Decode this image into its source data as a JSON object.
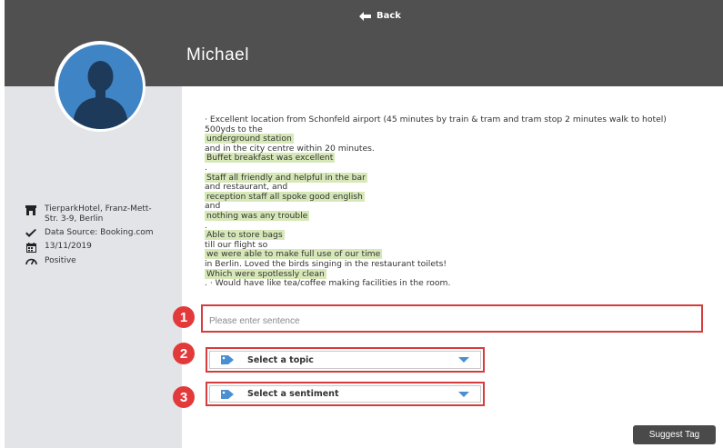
{
  "header": {
    "back_label": "Back",
    "user_name": "Michael"
  },
  "colors": {
    "header_bg": "#505050",
    "sidebar_bg": "#e3e4e8",
    "avatar": "#3f84c4",
    "highlight": "#d7e8b8",
    "callout": "#e23a3a"
  },
  "sidebar": {
    "hotel_lines": [
      "TierparkHotel, Franz-Mett-",
      "Str. 3-9, Berlin"
    ],
    "data_source": "Data Source: Booking.com",
    "date": "13/11/2019",
    "sentiment": "Positive"
  },
  "review": {
    "lines": [
      {
        "text": "· Excellent location from Schonfeld airport (45 minutes by train & tram and tram stop 2 minutes walk to hotel)",
        "highlight": false
      },
      {
        "text": "500yds to the",
        "highlight": false
      },
      {
        "text": "underground station",
        "highlight": true
      },
      {
        "text": "and in the city centre within 20 minutes.",
        "highlight": false
      },
      {
        "text": "Buffet breakfast was excellent",
        "highlight": true
      },
      {
        "text": ".",
        "highlight": false
      },
      {
        "text": "Staff all friendly and helpful in the bar",
        "highlight": true
      },
      {
        "text": "and restaurant, and",
        "highlight": false
      },
      {
        "text": "reception staff all spoke good english",
        "highlight": true
      },
      {
        "text": "and",
        "highlight": false
      },
      {
        "text": "nothing was any trouble",
        "highlight": true
      },
      {
        "text": ".",
        "highlight": false
      },
      {
        "text": "Able to store bags",
        "highlight": true
      },
      {
        "text": "till our flight so",
        "highlight": false
      },
      {
        "text": "we were able to make full use of our time",
        "highlight": true
      },
      {
        "text": "in Berlin. Loved the birds singing in the restaurant toilets!",
        "highlight": false
      },
      {
        "text": "Which were spotlessly clean",
        "highlight": true
      },
      {
        "text": ". · Would have like tea/coffee making facilities in the room.",
        "highlight": false
      }
    ]
  },
  "form": {
    "callouts": [
      "1",
      "2",
      "3"
    ],
    "sentence_placeholder": "Please enter sentence",
    "topic_label": "Select a topic",
    "sentiment_label": "Select a sentiment",
    "suggest_label": "Suggest Tag"
  },
  "icons": {
    "back": "arrow-left-icon",
    "hotel": "store-icon",
    "source": "check-icon",
    "date": "calendar-icon",
    "sentiment": "gauge-icon",
    "tag": "tag-icon",
    "caret": "chevron-down-icon"
  }
}
